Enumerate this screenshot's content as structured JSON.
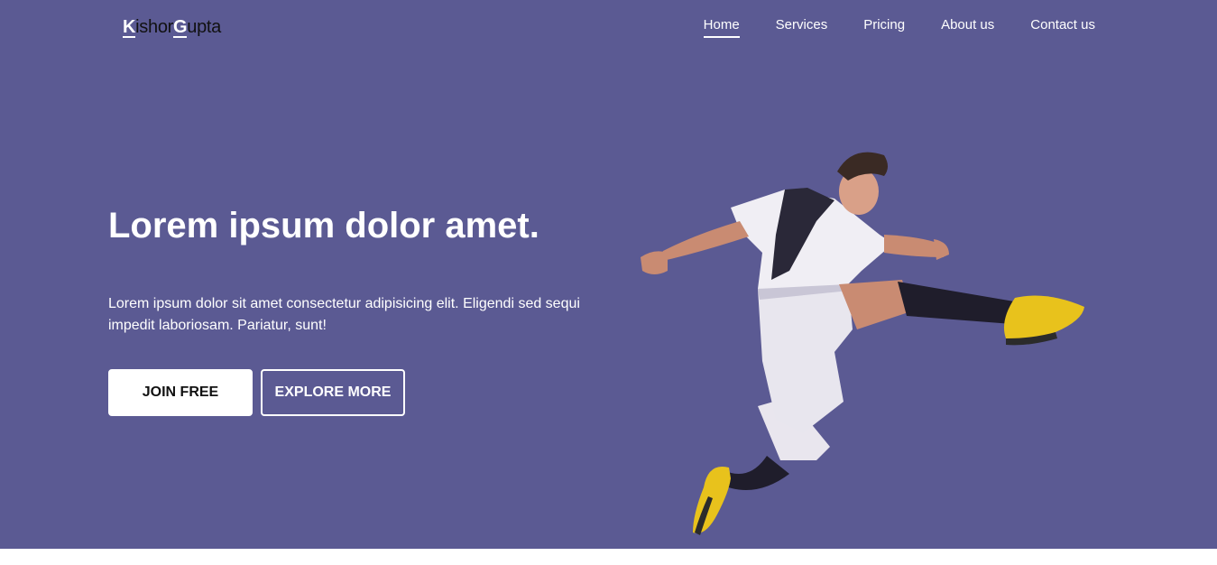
{
  "header": {
    "logo": {
      "first_initial": "K",
      "first_rest": "ishor",
      "last_initial": "G",
      "last_rest": "upta"
    },
    "nav": [
      {
        "label": "Home",
        "active": true
      },
      {
        "label": "Services",
        "active": false
      },
      {
        "label": "Pricing",
        "active": false
      },
      {
        "label": "About us",
        "active": false
      },
      {
        "label": "Contact us",
        "active": false
      }
    ]
  },
  "hero": {
    "title": "Lorem ipsum dolor amet.",
    "description": "Lorem ipsum dolor sit amet consectetur adipisicing elit. Eligendi sed sequi impedit laboriosam. Pariatur, sunt!",
    "primary_button": "JOIN FREE",
    "secondary_button": "EXPLORE MORE"
  },
  "colors": {
    "hero_background": "#5b5a93",
    "page_background": "#ffffff",
    "text_light": "#ffffff",
    "text_dark": "#111111",
    "boot_accent": "#e8c21c"
  }
}
